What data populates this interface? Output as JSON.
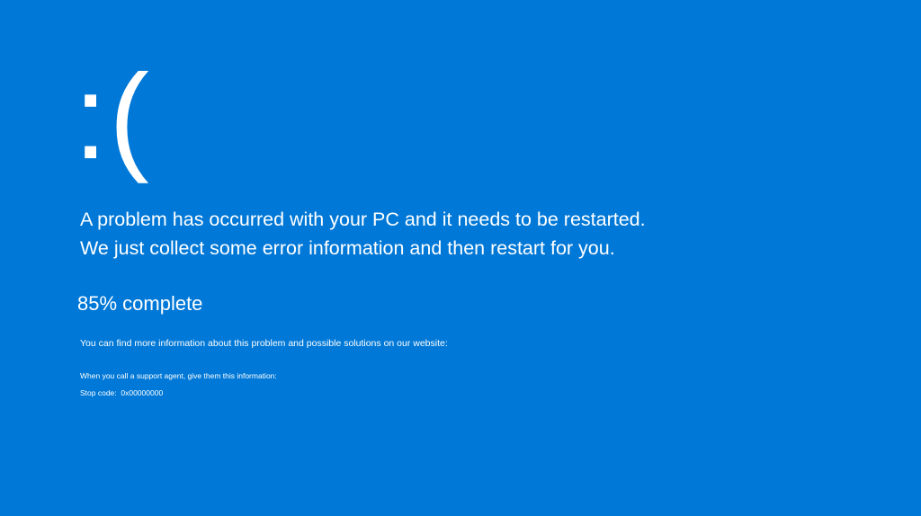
{
  "theme": {
    "background_color": "#0078d7",
    "text_color": "#ffffff"
  },
  "face": {
    "text": ":("
  },
  "message": {
    "line1": "A problem has occurred with your PC and it needs to be restarted.",
    "line2": "We just collect some error information and then restart for you."
  },
  "progress": {
    "percent": 85,
    "text": "85% complete"
  },
  "info": {
    "website_text": "You can find more information about this problem and possible solutions on our website:"
  },
  "support": {
    "text": "When you call a support agent, give them this information:"
  },
  "stop_code": {
    "label": "Stop code:",
    "value": "0x00000000"
  }
}
